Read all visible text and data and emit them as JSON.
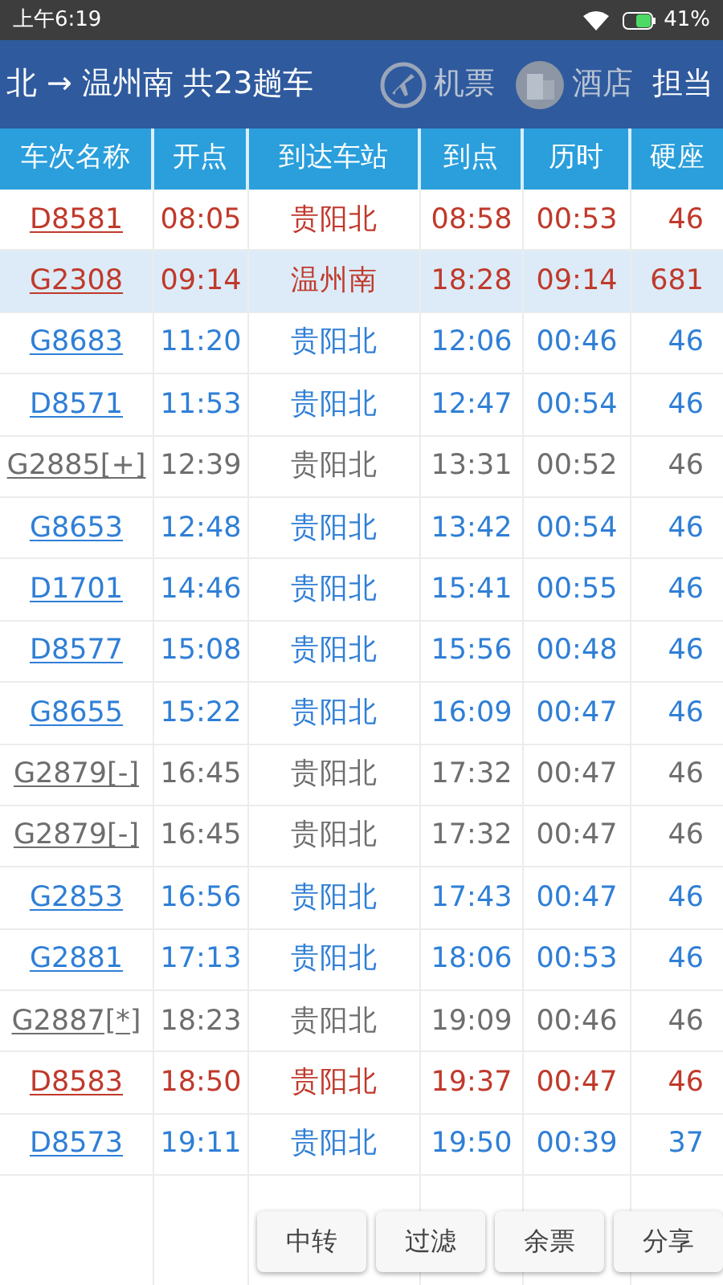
{
  "status_bar": {
    "time": "上午6:19",
    "battery": "41%"
  },
  "title_bar": {
    "route": "北 → 温州南 共23趟车",
    "actions": [
      {
        "kind": "plane",
        "label": "机票"
      },
      {
        "kind": "hotel",
        "label": "酒店"
      },
      {
        "kind": "text",
        "label": "担当"
      }
    ]
  },
  "table": {
    "columns": [
      "车次名称",
      "开点",
      "到达车站",
      "到点",
      "历时",
      "硬座"
    ],
    "rows": [
      {
        "cells": [
          "D8581",
          "08:05",
          "贵阳北",
          "08:58",
          "00:53",
          "46"
        ],
        "color": "#c0392b",
        "selected": false
      },
      {
        "cells": [
          "G2308",
          "09:14",
          "温州南",
          "18:28",
          "09:14",
          "681"
        ],
        "color": "#c0392b",
        "selected": true
      },
      {
        "cells": [
          "G8683",
          "11:20",
          "贵阳北",
          "12:06",
          "00:46",
          "46"
        ],
        "color": "#2f7fd6",
        "selected": false
      },
      {
        "cells": [
          "D8571",
          "11:53",
          "贵阳北",
          "12:47",
          "00:54",
          "46"
        ],
        "color": "#2f7fd6",
        "selected": false
      },
      {
        "cells": [
          "G2885[+]",
          "12:39",
          "贵阳北",
          "13:31",
          "00:52",
          "46"
        ],
        "color": "#6e6e6e",
        "selected": false
      },
      {
        "cells": [
          "G8653",
          "12:48",
          "贵阳北",
          "13:42",
          "00:54",
          "46"
        ],
        "color": "#2f7fd6",
        "selected": false
      },
      {
        "cells": [
          "D1701",
          "14:46",
          "贵阳北",
          "15:41",
          "00:55",
          "46"
        ],
        "color": "#2f7fd6",
        "selected": false
      },
      {
        "cells": [
          "D8577",
          "15:08",
          "贵阳北",
          "15:56",
          "00:48",
          "46"
        ],
        "color": "#2f7fd6",
        "selected": false
      },
      {
        "cells": [
          "G8655",
          "15:22",
          "贵阳北",
          "16:09",
          "00:47",
          "46"
        ],
        "color": "#2f7fd6",
        "selected": false
      },
      {
        "cells": [
          "G2879[-]",
          "16:45",
          "贵阳北",
          "17:32",
          "00:47",
          "46"
        ],
        "color": "#6e6e6e",
        "selected": false
      },
      {
        "cells": [
          "G2879[-]",
          "16:45",
          "贵阳北",
          "17:32",
          "00:47",
          "46"
        ],
        "color": "#6e6e6e",
        "selected": false
      },
      {
        "cells": [
          "G2853",
          "16:56",
          "贵阳北",
          "17:43",
          "00:47",
          "46"
        ],
        "color": "#2f7fd6",
        "selected": false
      },
      {
        "cells": [
          "G2881",
          "17:13",
          "贵阳北",
          "18:06",
          "00:53",
          "46"
        ],
        "color": "#2f7fd6",
        "selected": false
      },
      {
        "cells": [
          "G2887[*]",
          "18:23",
          "贵阳北",
          "19:09",
          "00:46",
          "46"
        ],
        "color": "#6e6e6e",
        "selected": false
      },
      {
        "cells": [
          "D8583",
          "18:50",
          "贵阳北",
          "19:37",
          "00:47",
          "46"
        ],
        "color": "#c0392b",
        "selected": false
      },
      {
        "cells": [
          "D8573",
          "19:11",
          "贵阳北",
          "19:50",
          "00:39",
          "37"
        ],
        "color": "#2f7fd6",
        "selected": false
      }
    ]
  },
  "buttons": [
    "中转",
    "过滤",
    "余票",
    "分享"
  ]
}
